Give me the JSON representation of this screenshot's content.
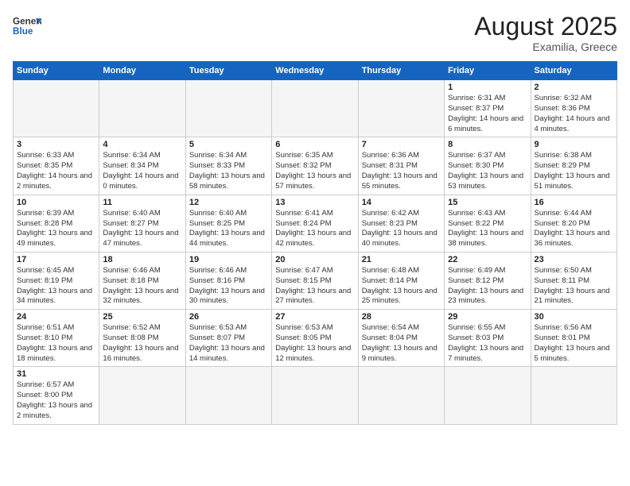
{
  "header": {
    "logo_general": "General",
    "logo_blue": "Blue",
    "title": "August 2025",
    "subtitle": "Examilia, Greece"
  },
  "weekdays": [
    "Sunday",
    "Monday",
    "Tuesday",
    "Wednesday",
    "Thursday",
    "Friday",
    "Saturday"
  ],
  "days": [
    {
      "date": "",
      "info": ""
    },
    {
      "date": "",
      "info": ""
    },
    {
      "date": "",
      "info": ""
    },
    {
      "date": "",
      "info": ""
    },
    {
      "date": "",
      "info": ""
    },
    {
      "date": "1",
      "info": "Sunrise: 6:31 AM\nSunset: 8:37 PM\nDaylight: 14 hours and 6 minutes."
    },
    {
      "date": "2",
      "info": "Sunrise: 6:32 AM\nSunset: 8:36 PM\nDaylight: 14 hours and 4 minutes."
    },
    {
      "date": "3",
      "info": "Sunrise: 6:33 AM\nSunset: 8:35 PM\nDaylight: 14 hours and 2 minutes."
    },
    {
      "date": "4",
      "info": "Sunrise: 6:34 AM\nSunset: 8:34 PM\nDaylight: 14 hours and 0 minutes."
    },
    {
      "date": "5",
      "info": "Sunrise: 6:34 AM\nSunset: 8:33 PM\nDaylight: 13 hours and 58 minutes."
    },
    {
      "date": "6",
      "info": "Sunrise: 6:35 AM\nSunset: 8:32 PM\nDaylight: 13 hours and 57 minutes."
    },
    {
      "date": "7",
      "info": "Sunrise: 6:36 AM\nSunset: 8:31 PM\nDaylight: 13 hours and 55 minutes."
    },
    {
      "date": "8",
      "info": "Sunrise: 6:37 AM\nSunset: 8:30 PM\nDaylight: 13 hours and 53 minutes."
    },
    {
      "date": "9",
      "info": "Sunrise: 6:38 AM\nSunset: 8:29 PM\nDaylight: 13 hours and 51 minutes."
    },
    {
      "date": "10",
      "info": "Sunrise: 6:39 AM\nSunset: 8:28 PM\nDaylight: 13 hours and 49 minutes."
    },
    {
      "date": "11",
      "info": "Sunrise: 6:40 AM\nSunset: 8:27 PM\nDaylight: 13 hours and 47 minutes."
    },
    {
      "date": "12",
      "info": "Sunrise: 6:40 AM\nSunset: 8:25 PM\nDaylight: 13 hours and 44 minutes."
    },
    {
      "date": "13",
      "info": "Sunrise: 6:41 AM\nSunset: 8:24 PM\nDaylight: 13 hours and 42 minutes."
    },
    {
      "date": "14",
      "info": "Sunrise: 6:42 AM\nSunset: 8:23 PM\nDaylight: 13 hours and 40 minutes."
    },
    {
      "date": "15",
      "info": "Sunrise: 6:43 AM\nSunset: 8:22 PM\nDaylight: 13 hours and 38 minutes."
    },
    {
      "date": "16",
      "info": "Sunrise: 6:44 AM\nSunset: 8:20 PM\nDaylight: 13 hours and 36 minutes."
    },
    {
      "date": "17",
      "info": "Sunrise: 6:45 AM\nSunset: 8:19 PM\nDaylight: 13 hours and 34 minutes."
    },
    {
      "date": "18",
      "info": "Sunrise: 6:46 AM\nSunset: 8:18 PM\nDaylight: 13 hours and 32 minutes."
    },
    {
      "date": "19",
      "info": "Sunrise: 6:46 AM\nSunset: 8:16 PM\nDaylight: 13 hours and 30 minutes."
    },
    {
      "date": "20",
      "info": "Sunrise: 6:47 AM\nSunset: 8:15 PM\nDaylight: 13 hours and 27 minutes."
    },
    {
      "date": "21",
      "info": "Sunrise: 6:48 AM\nSunset: 8:14 PM\nDaylight: 13 hours and 25 minutes."
    },
    {
      "date": "22",
      "info": "Sunrise: 6:49 AM\nSunset: 8:12 PM\nDaylight: 13 hours and 23 minutes."
    },
    {
      "date": "23",
      "info": "Sunrise: 6:50 AM\nSunset: 8:11 PM\nDaylight: 13 hours and 21 minutes."
    },
    {
      "date": "24",
      "info": "Sunrise: 6:51 AM\nSunset: 8:10 PM\nDaylight: 13 hours and 18 minutes."
    },
    {
      "date": "25",
      "info": "Sunrise: 6:52 AM\nSunset: 8:08 PM\nDaylight: 13 hours and 16 minutes."
    },
    {
      "date": "26",
      "info": "Sunrise: 6:53 AM\nSunset: 8:07 PM\nDaylight: 13 hours and 14 minutes."
    },
    {
      "date": "27",
      "info": "Sunrise: 6:53 AM\nSunset: 8:05 PM\nDaylight: 13 hours and 12 minutes."
    },
    {
      "date": "28",
      "info": "Sunrise: 6:54 AM\nSunset: 8:04 PM\nDaylight: 13 hours and 9 minutes."
    },
    {
      "date": "29",
      "info": "Sunrise: 6:55 AM\nSunset: 8:03 PM\nDaylight: 13 hours and 7 minutes."
    },
    {
      "date": "30",
      "info": "Sunrise: 6:56 AM\nSunset: 8:01 PM\nDaylight: 13 hours and 5 minutes."
    },
    {
      "date": "31",
      "info": "Sunrise: 6:57 AM\nSunset: 8:00 PM\nDaylight: 13 hours and 2 minutes."
    },
    {
      "date": "",
      "info": ""
    },
    {
      "date": "",
      "info": ""
    },
    {
      "date": "",
      "info": ""
    },
    {
      "date": "",
      "info": ""
    },
    {
      "date": "",
      "info": ""
    },
    {
      "date": "",
      "info": ""
    }
  ]
}
